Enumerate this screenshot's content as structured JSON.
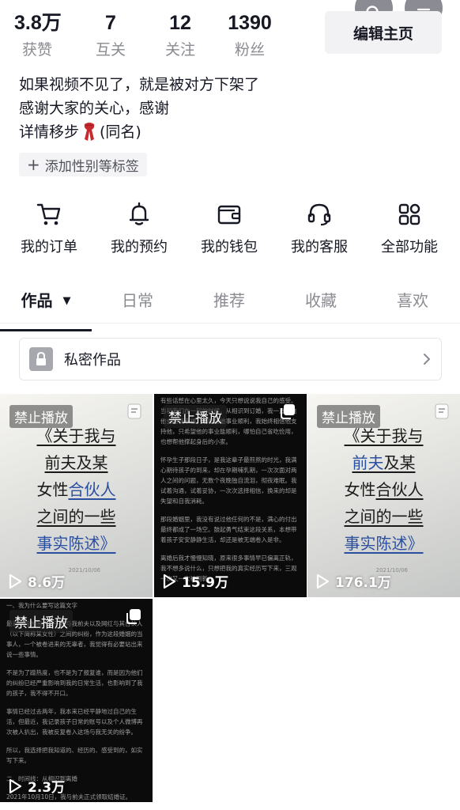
{
  "stats": [
    {
      "value": "3.8万",
      "label": "获赞"
    },
    {
      "value": "7",
      "label": "互关"
    },
    {
      "value": "12",
      "label": "关注"
    },
    {
      "value": "1390",
      "label": "粉丝"
    }
  ],
  "header": {
    "edit_label": "编辑主页",
    "search_icon": "search-icon",
    "menu_icon": "menu-icon"
  },
  "bio": {
    "line1": "如果视频不见了，就是被对方下架了",
    "line2": "感谢大家的关心，感谢",
    "line3_pre": "详情移步",
    "line3_post": "(同名)"
  },
  "tag_chip": {
    "label": "添加性别等标签"
  },
  "quick_actions": [
    {
      "label": "我的订单",
      "icon": "cart-icon"
    },
    {
      "label": "我的预约",
      "icon": "bell-icon"
    },
    {
      "label": "我的钱包",
      "icon": "wallet-icon"
    },
    {
      "label": "我的客服",
      "icon": "headset-icon"
    },
    {
      "label": "全部功能",
      "icon": "apps-icon"
    }
  ],
  "tabs": [
    "作品",
    "日常",
    "推荐",
    "收藏",
    "喜欢"
  ],
  "tab_dropdown": "▼",
  "private_works": {
    "label": "私密作品"
  },
  "videos": [
    {
      "badge": "禁止播放",
      "views": "8.6万",
      "style": "light",
      "cover": {
        "l1": "《关于我与",
        "l2": "前夫及某",
        "l3a": "女性",
        "l3b": "合伙人",
        "l4": "之间的一些",
        "l5": "事实陈述》",
        "date": "2021/10/06"
      }
    },
    {
      "badge": "禁止播放",
      "views": "15.9万",
      "style": "dark",
      "text": [
        "有些话憋在心里太久，今天只想说说我自己的感受。当初我们在一起的时候，从相识到订婚，我一直相信他会给我幸福，也相信他事业顺利，我始终相信他支持他，只希望他的事业能顺利，哪怕自己省吃俭用，也想帮他撑起身后的小家。",
        "怀孕生子那段日子，是我这辈子最煎熬的时光，我满心期待孩子的到来，却在孕期哺乳期，一次次面对两人之间的问题，无数个夜晚独自流泪，彻夜难眠。我试着沟通，试着妥协，一次次选择相信，换来的却是失望和自我消耗。",
        "那段婚姻里，我没有说过他任何的不是，满心的付出最终都成了一场空。鼓起勇气结束这段关系，本想带着孩子安安静静生活，却还是被无端卷入是非。",
        "离婚后我才慢慢知晓，原来很多事情早已偏离正轨，我不想多说什么，只想把我的真实经历写下来，三观一次又一次被刷新。"
      ]
    },
    {
      "badge": "禁止播放",
      "views": "176.1万",
      "style": "light",
      "cover": {
        "l1": "《关于我与",
        "l2": "前夫及某",
        "l3a": "女性",
        "l3b": "合伙人",
        "l4": "之间的一些",
        "l5": "事实陈述》",
        "date": "2021/10/06"
      }
    },
    {
      "badge": "禁止播放",
      "views": "2.3万",
      "style": "dark",
      "text": [
        "一、我为什么要写这篇文字",
        "最近一段时间，关于我与我前夫以及网红与其合伙人（以下简称某女性）之间的纠纷，作为这段婚姻的当事人，一个被卷进来的无辜者，我觉得有必要站出来说一些事情。",
        "不是为了蹭热度，也不是为了报复谁，而是因为他们的纠纷已经严重影响到我的日常生活，也影响到了我的孩子，我不得不开口。",
        "事情已经过去两年，我本来已经平静地过自己的生活，但最近，我记录孩子日常的账号以及个人微博再次被人扒出，我被反复卷入这场与我无关的纷争。",
        "所以，我选择把我知道的、经历的、感受到的，如实写下来。",
        "二、时间线：从相识到离婚",
        "2021年10月10日，我与前夫正式领取结婚证。"
      ]
    }
  ]
}
